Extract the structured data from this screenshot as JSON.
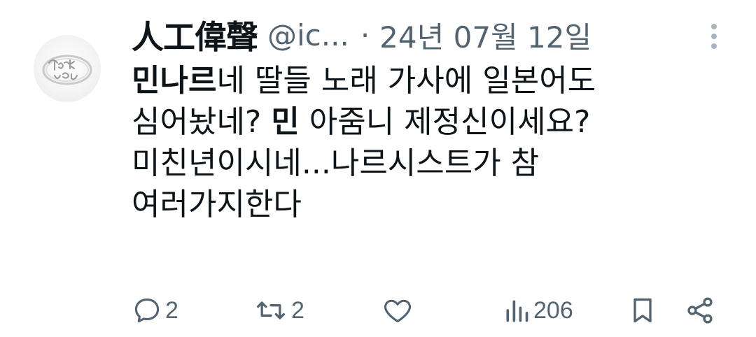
{
  "tweet": {
    "author_name": "人工偉聲",
    "handle": "@ic...",
    "separator": "·",
    "date": "24년 07월 12일",
    "avatar_alt": "ring-avatar",
    "body_lines": [
      {
        "bold": "민나르",
        "text": "네 딸들 노래 가사에 일본어도"
      },
      {
        "pre": "심어놨네? ",
        "bold": "민",
        "text": " 아줌니 제정신이세요?"
      },
      {
        "text": "미친년이시네...나르시스트가 참"
      },
      {
        "text": "여러가지한다"
      }
    ]
  },
  "actions": {
    "reply_count": "2",
    "retweet_count": "2",
    "like_count": "",
    "views_count": "206"
  },
  "colors": {
    "text": "#0f1419",
    "muted": "#536471",
    "background": "#ffffff"
  }
}
